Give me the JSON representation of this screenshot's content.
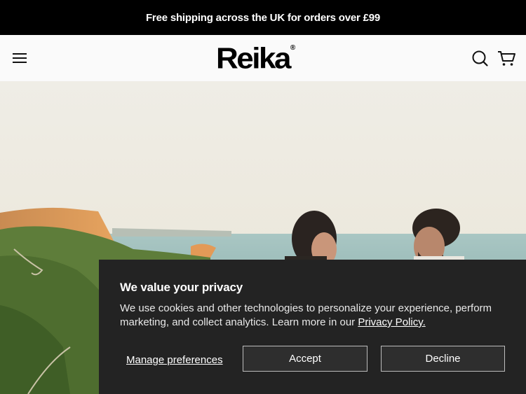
{
  "announcement": {
    "text": "Free shipping across the UK for orders over £99"
  },
  "header": {
    "logo_text": "Reika",
    "logo_mark": "®",
    "icons": {
      "menu": "hamburger-menu-icon",
      "search": "search-icon",
      "cart": "cart-icon"
    }
  },
  "hero": {
    "description": ""
  },
  "cookie_banner": {
    "title": "We value your privacy",
    "body": "We use cookies and other technologies to personalize your experience, perform marketing, and collect analytics. Learn more in our",
    "policy_link": "Privacy Policy.",
    "manage_label": "Manage preferences",
    "accept_label": "Accept",
    "decline_label": "Decline"
  },
  "colors": {
    "announcement_bg": "#000000",
    "header_bg": "#fafafa",
    "banner_bg": "#232323",
    "button_border": "#bdbdbd"
  }
}
